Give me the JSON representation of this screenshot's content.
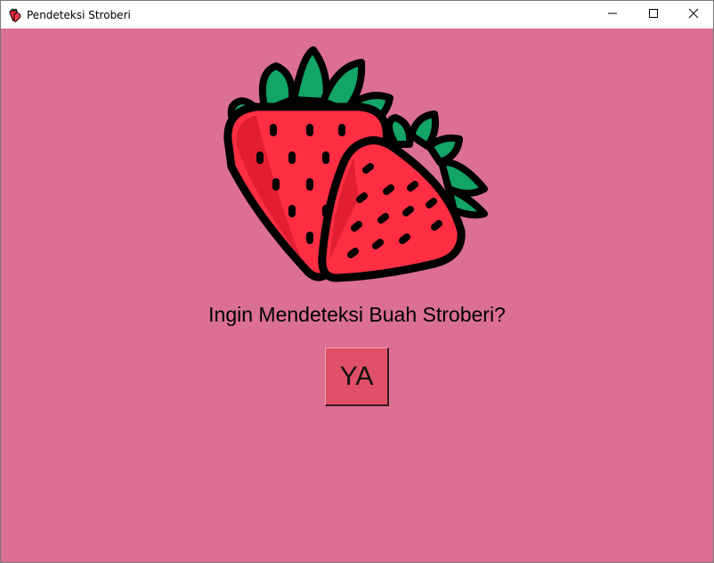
{
  "window": {
    "title": "Pendeteksi Stroberi",
    "app_icon": "strawberry-icon",
    "controls": [
      "minimize-icon",
      "maximize-icon",
      "close-icon"
    ]
  },
  "main": {
    "hero_image": "strawberries-illustration",
    "question": "Ingin Mendeteksi Buah Stroberi?",
    "confirm_label": "YA"
  },
  "colors": {
    "background": "#db7093",
    "button": "#e05068",
    "berry": "#ff2e43",
    "leaf": "#12a567"
  }
}
